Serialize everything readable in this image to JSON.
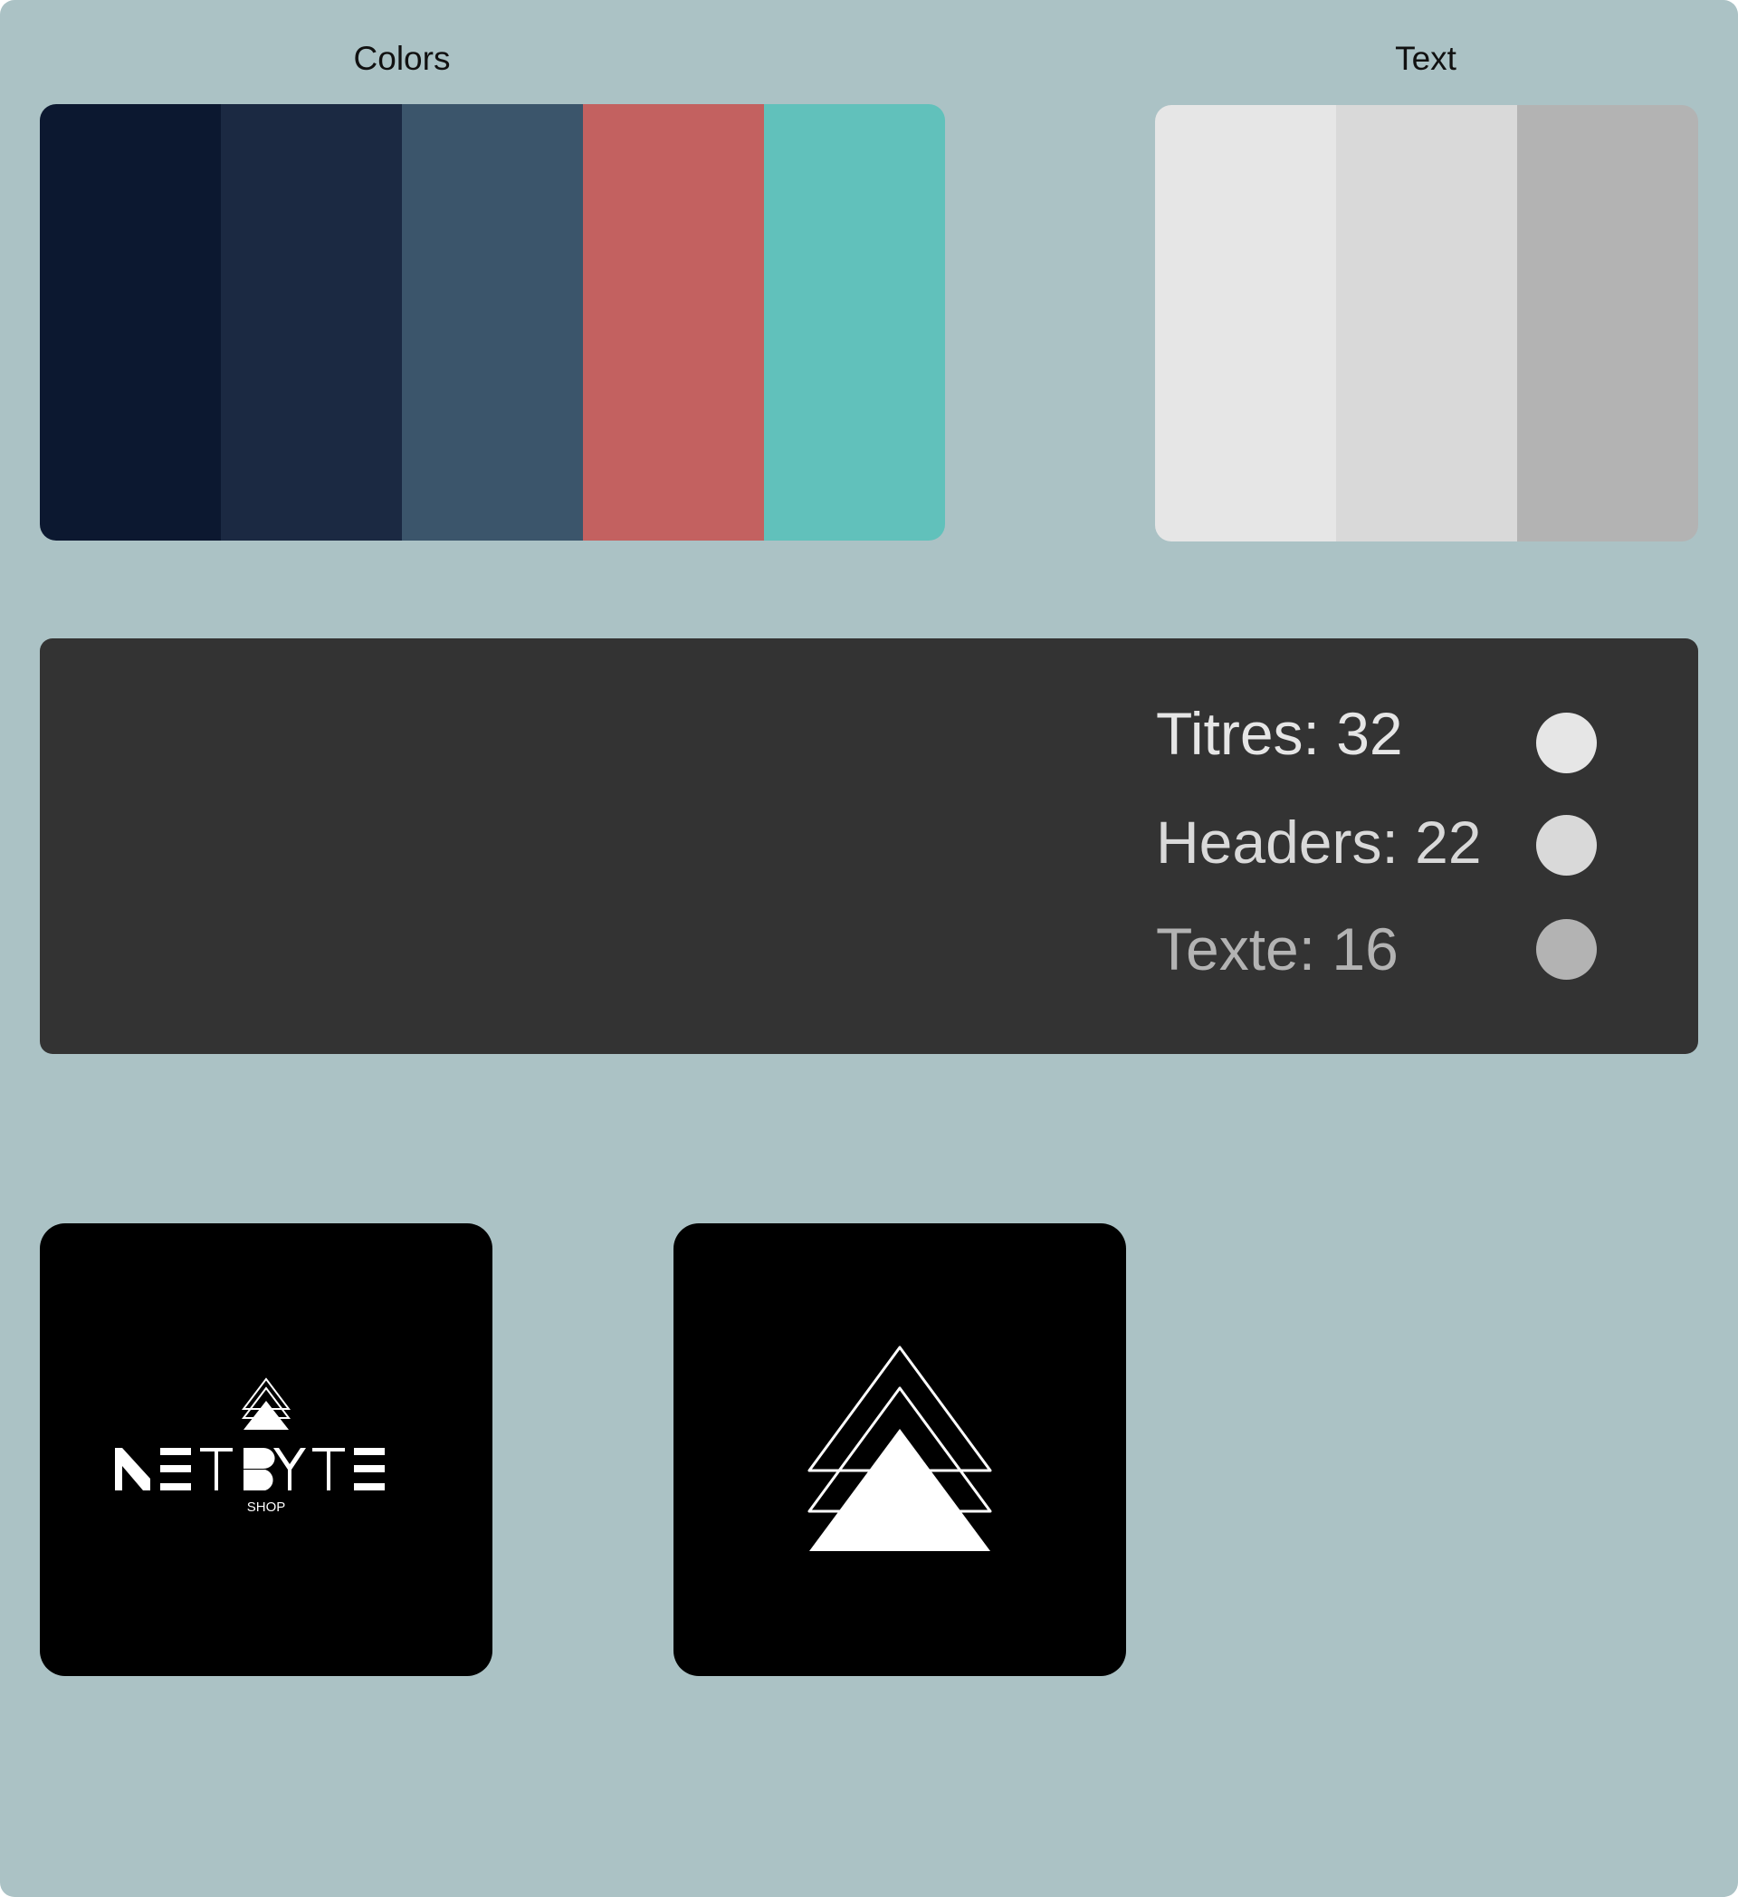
{
  "sections": {
    "colors_label": "Colors",
    "text_label": "Text"
  },
  "color_palette": [
    "#0c1830",
    "#1b2942",
    "#3b556b",
    "#c36160",
    "#61c1bb"
  ],
  "text_palette": [
    "#e6e6e6",
    "#d9d9d9",
    "#b3b3b3"
  ],
  "typography": [
    {
      "label": "Titres: 32",
      "color": "#e6e6e6",
      "dot": "#e6e6e6"
    },
    {
      "label": "Headers: 22",
      "color": "#d9d9d9",
      "dot": "#d9d9d9"
    },
    {
      "label": "Texte: 16",
      "color": "#b3b3b3",
      "dot": "#b3b3b3"
    }
  ],
  "logos": {
    "wordmark": "NETBYTE",
    "tagline": "SHOP",
    "symbol_icon": "stacked-triangles-icon"
  },
  "colors": {
    "board_background": "#abc2c5",
    "panel_background": "#333333",
    "logo_background": "#000000"
  }
}
